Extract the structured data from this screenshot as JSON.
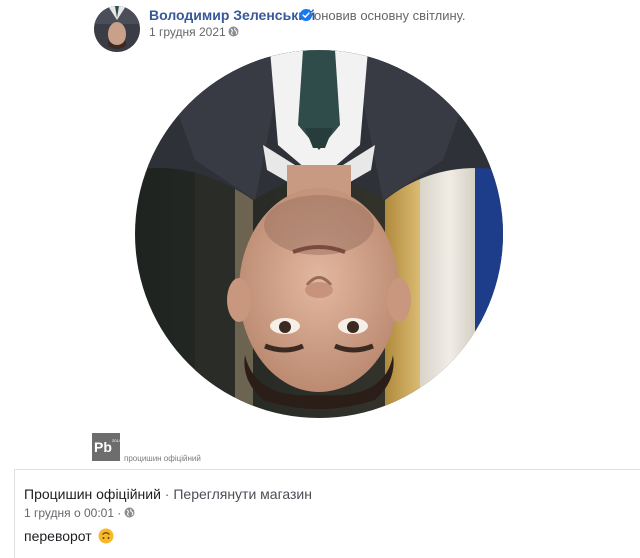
{
  "post": {
    "author": "Володимир Зеленський",
    "action": "оновив основну світлину.",
    "date": "1 грудня 2021",
    "privacy_icon": "globe-icon",
    "verified_icon": "verified-badge-icon"
  },
  "photo": {
    "description_icon": "profile-photo-upside-down",
    "flip": "upside-down"
  },
  "watermark": {
    "logo_text": "Pb",
    "logo_sub": "2014",
    "text": "процишин офіційний"
  },
  "share": {
    "page_name": "Процишин офіційний",
    "separator": "·",
    "shop_link": "Переглянути магазин",
    "date": "1 грудня о 00:01",
    "date_dot": "·",
    "privacy_icon": "globe-icon",
    "message": "переворот",
    "emoji": "upside-down-face-icon"
  },
  "colors": {
    "author_link": "#385898",
    "secondary_text": "#65676b",
    "divider": "#dddfe2",
    "verified_badge": "#1877f2",
    "emoji": "#f7b928"
  }
}
